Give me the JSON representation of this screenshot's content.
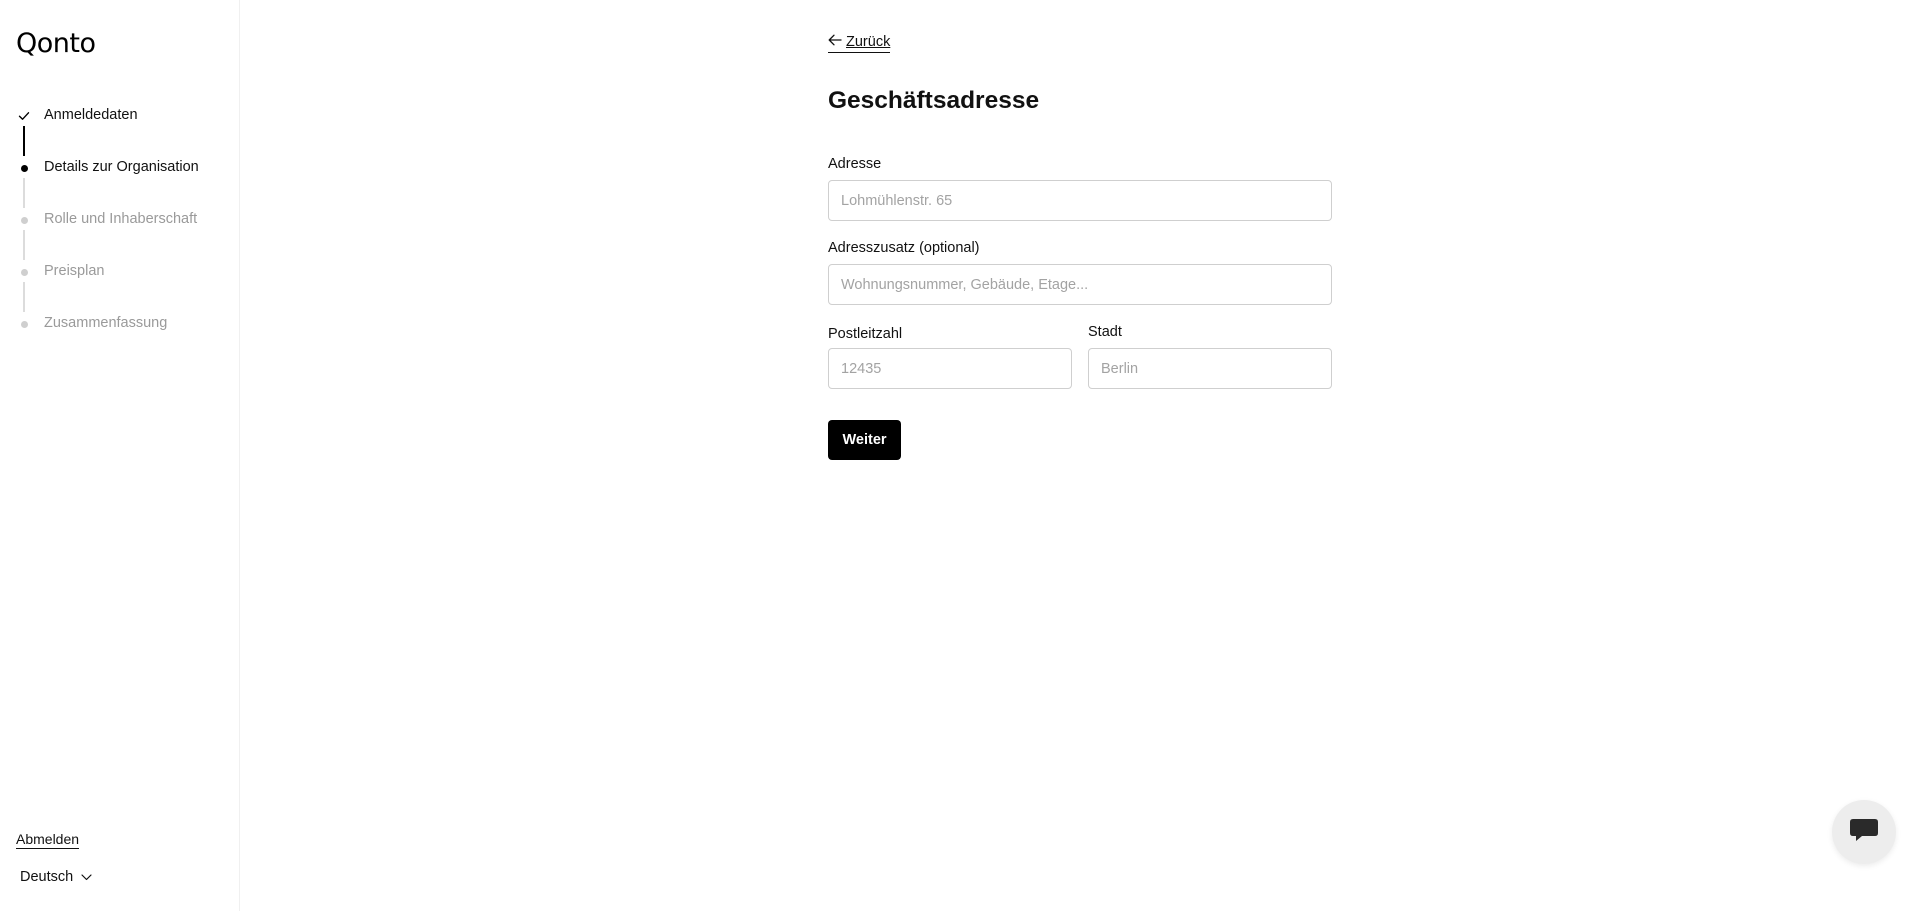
{
  "brand": {
    "logo_text": "Qonto"
  },
  "sidebar": {
    "steps": [
      {
        "label": "Anmeldedaten",
        "state": "done"
      },
      {
        "label": "Details zur Organisation",
        "state": "active"
      },
      {
        "label": "Rolle und Inhaberschaft",
        "state": "pending"
      },
      {
        "label": "Preisplan",
        "state": "pending"
      },
      {
        "label": "Zusammenfassung",
        "state": "pending"
      }
    ],
    "logout_label": "Abmelden",
    "language_label": "Deutsch"
  },
  "form": {
    "back_label": "Zurück",
    "title": "Geschäftsadresse",
    "address": {
      "label": "Adresse",
      "placeholder": "Lohmühlenstr. 65",
      "value": ""
    },
    "address_extra": {
      "label": "Adresszusatz (optional)",
      "placeholder": "Wohnungsnummer, Gebäude, Etage...",
      "value": ""
    },
    "postal_code": {
      "label": "Postleitzahl",
      "placeholder": "12435",
      "value": ""
    },
    "city": {
      "label": "Stadt",
      "placeholder": "Berlin",
      "value": ""
    },
    "submit_label": "Weiter"
  },
  "icons": {
    "step_done": "check-icon",
    "back": "arrow-left-icon",
    "language_toggle": "chevron-down-icon",
    "chat": "chat-bubble-icon"
  },
  "colors": {
    "primary": "#000000",
    "text": "#111111",
    "muted": "#9a9a9a",
    "border": "#cfcfcf",
    "chat_bg": "#ededed"
  }
}
